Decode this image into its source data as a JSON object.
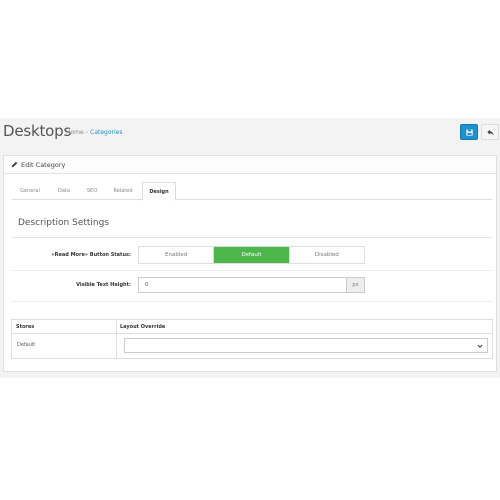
{
  "header": {
    "title": "Desktops",
    "breadcrumb": [
      {
        "label": "Home",
        "link": false
      },
      {
        "label": "Categories",
        "link": true
      }
    ],
    "save_icon": "save-icon",
    "back_icon": "reply-icon"
  },
  "panel": {
    "title": "Edit Category",
    "icon": "pencil-icon"
  },
  "tabs": [
    "General",
    "Data",
    "SEO",
    "Related",
    "Design"
  ],
  "active_tab": "Design",
  "section": {
    "legend": "Description Settings"
  },
  "fields": {
    "read_more": {
      "label": "«Read More» Button Status:",
      "options": [
        "Enabled",
        "Default",
        "Disabled"
      ],
      "selected": "Default"
    },
    "visible_height": {
      "label": "Visible Text Height:",
      "value": "0",
      "addon": "px"
    }
  },
  "layout_table": {
    "headers": [
      "Stores",
      "Layout Override"
    ],
    "rows": [
      {
        "store": "Default",
        "layout": ""
      }
    ]
  },
  "colors": {
    "primary": "#1e91cf",
    "success": "#4cb64c"
  }
}
